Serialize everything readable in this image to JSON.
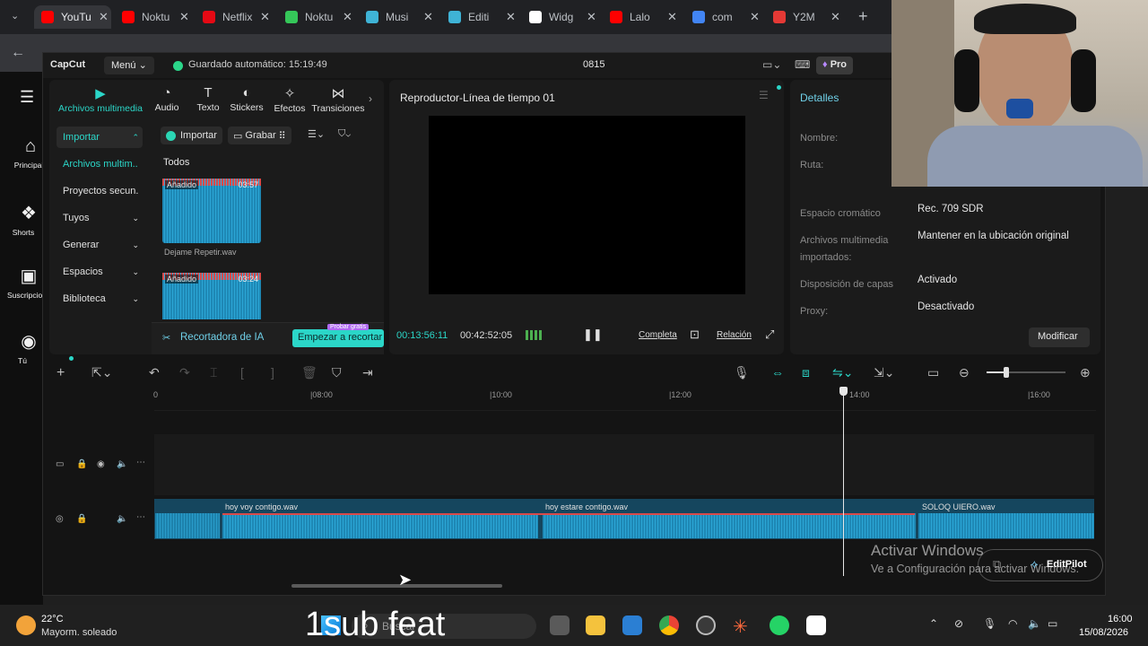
{
  "browser": {
    "tabs": [
      {
        "label": "YouTube",
        "color": "#ff0000",
        "active": true
      },
      {
        "label": "Noktu",
        "color": "#ff0000"
      },
      {
        "label": "Netflix",
        "color": "#e50914"
      },
      {
        "label": "Noktu",
        "color": "#35c759"
      },
      {
        "label": "Musi",
        "color": "#3fb3d6"
      },
      {
        "label": "Editi",
        "color": "#3fb3d6"
      },
      {
        "label": "Widg",
        "color": "#ffffff"
      },
      {
        "label": "Lalo",
        "color": "#ff0000"
      },
      {
        "label": "com",
        "color": "#4285f4"
      },
      {
        "label": "Y2M",
        "color": "#e53935"
      }
    ],
    "new_tab": "+"
  },
  "youtube": {
    "items": [
      {
        "icon": "home-icon",
        "label": "Principal"
      },
      {
        "icon": "shorts-icon",
        "label": "Shorts"
      },
      {
        "icon": "subscriptions-icon",
        "label": "Suscripciones"
      },
      {
        "icon": "user-icon",
        "label": "Tú"
      }
    ]
  },
  "capcut": {
    "logo": "CapCut",
    "menu": "Menú",
    "autosave": "Guardado automático: 15:19:49",
    "project_name": "0815",
    "pro_label": "Pro",
    "toolbar_tabs": [
      {
        "icon": "media-icon",
        "label": "Archivos multimedia",
        "active": true
      },
      {
        "icon": "audio-icon",
        "label": "Audio"
      },
      {
        "icon": "text-icon",
        "label": "Texto"
      },
      {
        "icon": "sticker-icon",
        "label": "Stickers"
      },
      {
        "icon": "effects-icon",
        "label": "Efectos"
      },
      {
        "icon": "transitions-icon",
        "label": "Transiciones"
      }
    ],
    "sidebar": [
      {
        "label": "Importar",
        "active": true
      },
      {
        "label": "Archivos multim..."
      },
      {
        "label": "Proyectos secun..."
      },
      {
        "label": "Tuyos"
      },
      {
        "label": "Generar"
      },
      {
        "label": "Espacios"
      },
      {
        "label": "Biblioteca"
      }
    ],
    "media": {
      "import_button": "Importar",
      "record_button": "Grabar",
      "filter_all": "Todos",
      "items": [
        {
          "badge": "Añadido",
          "duration": "03:57",
          "name": "Dejame Repetir.wav"
        },
        {
          "badge": "Añadido",
          "duration": "03:24",
          "name": ""
        }
      ],
      "ai_cutter": "Recortadora de IA",
      "start_cut": "Empezar a recortar",
      "trial_badge": "Probar gratis"
    },
    "player": {
      "title": "Reproductor-Línea de tiempo 01",
      "current_time": "00:13:56:11",
      "total_time": "00:42:52:05",
      "complete_label": "Completa",
      "ratio_label": "Relación"
    },
    "details": {
      "title": "Detalles",
      "rows": [
        {
          "key": "Nombre:",
          "value": ""
        },
        {
          "key": "Ruta:",
          "value": ""
        },
        {
          "key": "Espacio cromático",
          "value": "Rec. 709 SDR"
        },
        {
          "key": "Archivos multimedia importados:",
          "value": "Mantener en la ubicación original"
        },
        {
          "key": "Disposición de capas",
          "value": "Activado"
        },
        {
          "key": "Proxy:",
          "value": "Desactivado"
        }
      ],
      "modify_button": "Modificar"
    },
    "timeline": {
      "ruler": [
        "0",
        "|08:00",
        "|10:00",
        "|12:00",
        "14:00",
        "|16:00"
      ],
      "playhead_label": "14:00",
      "clips": [
        {
          "name": "hoy voy contigo.wav"
        },
        {
          "name": "hoy estare contigo.wav"
        },
        {
          "name": "SOLOQ UIERO.wav"
        }
      ]
    }
  },
  "overlay": {
    "activate_title": "Activar Windows",
    "activate_sub": "Ve a Configuración para activar Windows.",
    "editpilot": "EditPilot",
    "caption": "1sub feat"
  },
  "taskbar": {
    "weather_temp": "22°C",
    "weather_desc": "Mayorm. soleado",
    "search": "Buscar",
    "time": "16:00",
    "date": "15/08/2026"
  }
}
